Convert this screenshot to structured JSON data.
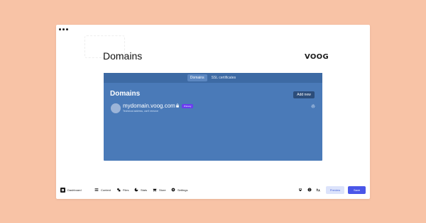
{
  "page": {
    "title": "Domains",
    "logo": "VOOG"
  },
  "panel": {
    "tabs": [
      {
        "label": "Domains",
        "active": true
      },
      {
        "label": "SSL certificates",
        "active": false
      }
    ],
    "title": "Domains",
    "add_button": "Add new",
    "domain": {
      "name": "mydomain.voog.com",
      "badge": "Primary",
      "subtitle": "Technical address, can't remove"
    }
  },
  "toolbar": {
    "items": [
      {
        "label": "Dashboard",
        "icon": "dashboard-icon"
      },
      {
        "label": "Content",
        "icon": "content-icon"
      },
      {
        "label": "Files",
        "icon": "files-icon"
      },
      {
        "label": "Stats",
        "icon": "stats-icon"
      },
      {
        "label": "Store",
        "icon": "store-icon"
      },
      {
        "label": "Settings",
        "icon": "settings-icon"
      }
    ],
    "preview_label": "Preview",
    "save_label": "Save"
  },
  "colors": {
    "background": "#f8c3a6",
    "panel": "#4a7ab8",
    "save": "#4a56e8",
    "badge": "#6b3cf0"
  }
}
